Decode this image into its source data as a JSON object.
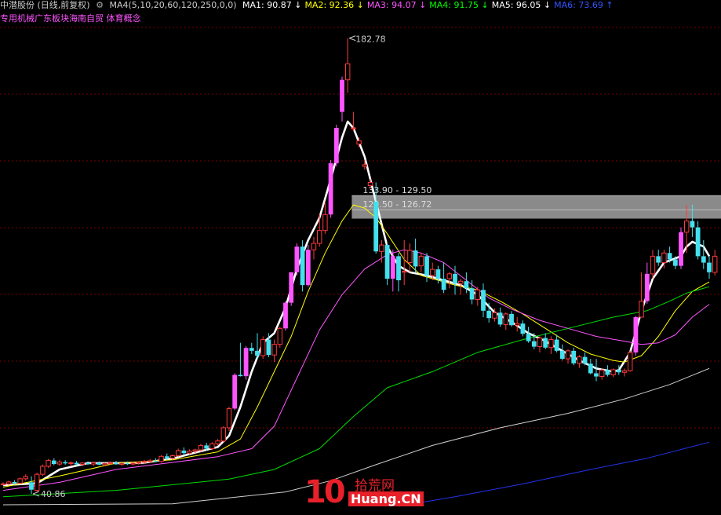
{
  "header": {
    "stock": "中潜股份 (日线,前复权)",
    "indicator": "MA4(5,10,20,60,120,250,0,0)",
    "ma": [
      {
        "label": "MA1: 90.87",
        "arrow": "↓",
        "color": "#ffffff"
      },
      {
        "label": "MA2: 92.36",
        "arrow": "↓",
        "color": "#ffff00"
      },
      {
        "label": "MA3: 94.07",
        "arrow": "↓",
        "color": "#ff55ff"
      },
      {
        "label": "MA4: 91.75",
        "arrow": "↓",
        "color": "#00ff00"
      },
      {
        "label": "MA5: 96.05",
        "arrow": "↓",
        "color": "#ffffff"
      },
      {
        "label": "MA6: 73.69",
        "arrow": "↑",
        "color": "#3355ff"
      }
    ],
    "concept": "专用机械广东板块海南自贸 体育概念"
  },
  "colors": {
    "up": "#ff3a3a",
    "down": "#44e0ee",
    "bigUp": "#ff55ff",
    "grid": "#7a0000",
    "gap": "#8a8a8a"
  },
  "chart_data": {
    "type": "candlestick",
    "ylim": [
      37,
      190
    ],
    "annotations": {
      "high": "182.78",
      "low": "40.86"
    },
    "gaps": [
      {
        "label": "133.90 - 129.50",
        "top": 133.9,
        "bottom": 129.5
      },
      {
        "label": "129.50 - 126.72",
        "top": 129.5,
        "bottom": 126.72
      }
    ],
    "candles": [
      [
        44,
        44.5,
        43.5,
        44
      ],
      [
        44,
        45,
        43.6,
        44.6
      ],
      [
        44.6,
        45.2,
        43.8,
        44.2
      ],
      [
        44.2,
        46,
        44,
        45.6
      ],
      [
        45.6,
        47,
        45,
        46.3
      ],
      [
        44.5,
        46.4,
        40.9,
        42.2
      ],
      [
        42,
        47.5,
        41.5,
        47
      ],
      [
        47,
        50,
        46.5,
        49.5
      ],
      [
        49.5,
        51.8,
        49,
        51.3
      ],
      [
        51.3,
        52,
        49.8,
        50.2
      ],
      [
        50.2,
        51.5,
        49.6,
        50.8
      ],
      [
        50.8,
        51.4,
        50,
        50.4
      ],
      [
        50.4,
        51,
        49.5,
        50.6
      ],
      [
        50.6,
        51.2,
        49.8,
        50.1
      ],
      [
        50.1,
        50.8,
        49.5,
        50.5
      ],
      [
        50.5,
        51,
        49.9,
        50.2
      ],
      [
        50.2,
        50.8,
        49.6,
        50.6
      ],
      [
        50.6,
        51,
        49.8,
        50
      ],
      [
        50,
        50.6,
        49.5,
        50.4
      ],
      [
        50.4,
        51,
        50,
        50.6
      ],
      [
        50.6,
        51.2,
        50,
        50.1
      ],
      [
        50.1,
        50.7,
        49.6,
        50.4
      ],
      [
        50.4,
        51,
        49.9,
        50.2
      ],
      [
        50.2,
        50.8,
        49.7,
        50.5
      ],
      [
        50.5,
        51,
        50,
        50.8
      ],
      [
        50.8,
        51.5,
        50.2,
        51
      ],
      [
        51,
        51.8,
        50.5,
        51.2
      ],
      [
        51.2,
        52,
        50.8,
        51
      ],
      [
        51,
        53,
        50.6,
        52.6
      ],
      [
        52.6,
        53.5,
        51.5,
        52
      ],
      [
        52,
        53.2,
        51.4,
        52.8
      ],
      [
        52.8,
        55,
        52.5,
        54.4
      ],
      [
        54.4,
        55.4,
        53,
        53.6
      ],
      [
        53.6,
        54.8,
        53.2,
        54.2
      ],
      [
        54.2,
        55,
        53.6,
        54.6
      ],
      [
        54.6,
        56.5,
        54,
        56
      ],
      [
        56,
        56.8,
        54.4,
        55
      ],
      [
        55,
        57,
        54.5,
        56.5
      ],
      [
        56.5,
        58,
        56,
        57.4
      ],
      [
        57.4,
        62,
        57,
        61.5
      ],
      [
        61.5,
        68,
        60.5,
        67.5
      ],
      [
        67.5,
        78.5,
        67,
        78
      ],
      [
        78,
        88,
        77.5,
        77.6
      ],
      [
        77.6,
        87,
        76.5,
        86.4
      ],
      [
        86.4,
        88,
        84.5,
        85.5
      ],
      [
        85.5,
        91,
        83,
        84
      ],
      [
        84,
        90,
        83,
        89
      ],
      [
        89,
        91,
        83.5,
        84.2
      ],
      [
        84.2,
        89,
        82,
        87.5
      ],
      [
        87.5,
        93,
        86.5,
        92.5
      ],
      [
        92.5,
        101,
        91.8,
        100.5
      ],
      [
        100.5,
        110,
        99.5,
        110
      ],
      [
        110,
        119,
        109,
        118
      ],
      [
        118,
        120,
        104,
        106
      ],
      [
        106,
        118.5,
        105.5,
        117
      ],
      [
        117,
        121,
        114,
        119
      ],
      [
        119,
        128,
        118,
        123
      ],
      [
        123,
        132,
        122,
        128
      ],
      [
        128,
        145,
        127,
        144
      ],
      [
        144,
        156,
        143,
        155
      ],
      [
        160,
        171,
        157,
        170
      ],
      [
        170,
        183,
        166,
        175
      ],
      [
        155,
        160,
        154,
        155
      ],
      [
        150,
        152,
        149,
        151
      ],
      [
        143,
        145,
        142,
        143.5
      ],
      [
        137,
        139,
        136,
        138
      ],
      [
        132,
        138,
        115.8,
        116.5
      ],
      [
        116.5,
        120,
        113,
        118.5
      ],
      [
        118.5,
        119,
        106,
        108
      ],
      [
        108,
        117,
        104,
        115
      ],
      [
        115,
        116,
        104,
        107.5
      ],
      [
        110,
        120,
        106,
        110.3
      ],
      [
        113,
        119,
        110,
        116.8
      ],
      [
        116.8,
        120.5,
        110,
        111.8
      ],
      [
        112,
        116,
        110,
        115
      ],
      [
        115,
        116,
        107,
        109
      ],
      [
        109,
        113,
        107.5,
        110.9
      ],
      [
        110.9,
        112,
        106.5,
        108
      ],
      [
        108,
        113,
        103.5,
        104.5
      ],
      [
        108,
        110,
        105,
        109.5
      ],
      [
        109.5,
        112,
        103,
        106.5
      ],
      [
        106.5,
        108,
        103,
        107.2
      ],
      [
        107.2,
        110,
        103.5,
        105
      ],
      [
        105,
        107.5,
        100,
        101.5
      ],
      [
        101.5,
        105.5,
        99.5,
        104.5
      ],
      [
        104.5,
        106.5,
        96,
        98
      ],
      [
        98,
        100.5,
        94.3,
        95.7
      ],
      [
        95.7,
        98.8,
        94.6,
        97.4
      ],
      [
        97.4,
        99,
        93,
        93.7
      ],
      [
        93.7,
        97.5,
        92,
        97
      ],
      [
        97,
        97.9,
        93,
        93.5
      ],
      [
        93.5,
        96,
        91.5,
        94
      ],
      [
        94,
        95,
        90,
        90.8
      ],
      [
        90.8,
        93,
        88,
        88.5
      ],
      [
        88.5,
        91,
        86,
        86.8
      ],
      [
        86.8,
        90,
        85,
        89.5
      ],
      [
        89.5,
        91,
        86,
        86.5
      ],
      [
        86.5,
        90,
        84.5,
        89
      ],
      [
        89,
        90.5,
        85,
        85.5
      ],
      [
        85.5,
        87.5,
        82.5,
        83
      ],
      [
        83,
        86,
        81.5,
        85.5
      ],
      [
        85.5,
        86.5,
        81,
        81.6
      ],
      [
        81.6,
        84.2,
        80.2,
        83.6
      ],
      [
        83.6,
        85,
        81,
        81.5
      ],
      [
        81.5,
        83,
        78.2,
        78.5
      ],
      [
        78.5,
        83,
        76,
        77.5
      ],
      [
        77.5,
        80,
        76.5,
        79.5
      ],
      [
        79.5,
        81,
        77.5,
        78
      ],
      [
        78,
        80,
        77.3,
        79.6
      ],
      [
        79.6,
        81,
        78,
        78.8
      ],
      [
        78.8,
        80,
        77.5,
        79.3
      ],
      [
        79.3,
        85.5,
        79,
        85
      ],
      [
        85,
        96.4,
        84,
        96
      ],
      [
        96,
        110,
        96.2,
        101
      ],
      [
        101,
        113,
        100.2,
        109.5
      ],
      [
        109.5,
        117,
        108,
        115
      ],
      [
        115,
        117,
        112,
        113
      ],
      [
        113,
        117,
        111.2,
        116
      ],
      [
        116,
        118,
        113,
        114
      ],
      [
        114,
        115,
        111,
        112
      ],
      [
        112,
        124,
        111,
        122.5
      ],
      [
        122.5,
        131,
        116,
        126
      ],
      [
        126,
        131,
        121,
        124
      ],
      [
        124,
        126,
        114,
        115
      ],
      [
        115,
        120,
        111,
        113
      ],
      [
        113,
        115,
        108,
        110
      ],
      [
        110,
        117,
        109,
        115
      ]
    ],
    "ma_series": [
      {
        "name": "MA1",
        "color": "#ffffff",
        "width": 2.6,
        "points": [
          [
            0,
            43.6
          ],
          [
            6,
            44.2
          ],
          [
            10,
            48.5
          ],
          [
            15,
            50.5
          ],
          [
            20,
            50.5
          ],
          [
            25,
            50.6
          ],
          [
            30,
            51.9
          ],
          [
            35,
            54.2
          ],
          [
            38,
            55.5
          ],
          [
            40,
            59
          ],
          [
            42,
            68
          ],
          [
            44,
            79
          ],
          [
            46,
            88
          ],
          [
            48,
            91
          ],
          [
            50,
            99
          ],
          [
            52,
            111
          ],
          [
            54,
            120
          ],
          [
            56,
            127
          ],
          [
            58,
            139
          ],
          [
            60,
            152
          ],
          [
            61,
            157
          ],
          [
            62,
            155
          ],
          [
            64,
            146
          ],
          [
            66,
            132
          ],
          [
            68,
            118
          ],
          [
            70,
            112
          ],
          [
            72,
            110
          ],
          [
            75,
            109
          ],
          [
            78,
            107.5
          ],
          [
            81,
            106
          ],
          [
            84,
            103
          ],
          [
            87,
            97.5
          ],
          [
            90,
            94.5
          ],
          [
            93,
            91
          ],
          [
            96,
            88.5
          ],
          [
            99,
            85.5
          ],
          [
            102,
            82.5
          ],
          [
            105,
            80
          ],
          [
            108,
            79
          ],
          [
            109,
            79.5
          ],
          [
            111,
            85
          ],
          [
            113,
            98
          ],
          [
            115,
            108
          ],
          [
            117,
            113
          ],
          [
            120,
            115
          ],
          [
            121,
            118
          ],
          [
            122,
            119.5
          ],
          [
            124,
            118
          ],
          [
            125,
            115
          ]
        ]
      },
      {
        "name": "MA2",
        "color": "#ffff00",
        "width": 1,
        "points": [
          [
            0,
            43
          ],
          [
            10,
            46.5
          ],
          [
            20,
            50.5
          ],
          [
            30,
            51.5
          ],
          [
            38,
            54
          ],
          [
            42,
            58
          ],
          [
            45,
            68
          ],
          [
            48,
            79
          ],
          [
            51,
            90
          ],
          [
            54,
            104
          ],
          [
            57,
            116
          ],
          [
            60,
            126
          ],
          [
            62,
            131
          ],
          [
            64,
            130
          ],
          [
            66,
            127
          ],
          [
            68,
            122
          ],
          [
            71,
            114
          ],
          [
            74,
            109
          ],
          [
            77,
            107.5
          ],
          [
            80,
            106
          ],
          [
            84,
            104.5
          ],
          [
            88,
            101
          ],
          [
            92,
            97
          ],
          [
            96,
            92.5
          ],
          [
            100,
            88
          ],
          [
            104,
            84.5
          ],
          [
            108,
            82.5
          ],
          [
            110,
            82
          ],
          [
            113,
            84
          ],
          [
            116,
            90
          ],
          [
            119,
            98
          ],
          [
            122,
            104
          ],
          [
            125,
            107
          ]
        ]
      },
      {
        "name": "MA3",
        "color": "#ff55ff",
        "width": 1,
        "points": [
          [
            0,
            42
          ],
          [
            10,
            44.5
          ],
          [
            20,
            48.5
          ],
          [
            30,
            50.7
          ],
          [
            38,
            52.5
          ],
          [
            44,
            55
          ],
          [
            48,
            62
          ],
          [
            52,
            77
          ],
          [
            56,
            92
          ],
          [
            60,
            103
          ],
          [
            64,
            111
          ],
          [
            68,
            115.5
          ],
          [
            71,
            117
          ],
          [
            74,
            116
          ],
          [
            78,
            113
          ],
          [
            82,
            107.5
          ],
          [
            86,
            102
          ],
          [
            90,
            98.5
          ],
          [
            95,
            95
          ],
          [
            100,
            92.5
          ],
          [
            105,
            90
          ],
          [
            110,
            88.5
          ],
          [
            113,
            87.5
          ],
          [
            116,
            88
          ],
          [
            119,
            90.5
          ],
          [
            122,
            96
          ],
          [
            125,
            100
          ]
        ]
      },
      {
        "name": "MA4",
        "color": "#00dd00",
        "width": 1,
        "points": [
          [
            0,
            40
          ],
          [
            20,
            42
          ],
          [
            40,
            45.5
          ],
          [
            48,
            48.5
          ],
          [
            56,
            55
          ],
          [
            62,
            65
          ],
          [
            68,
            74
          ],
          [
            76,
            79
          ],
          [
            84,
            85
          ],
          [
            92,
            89
          ],
          [
            100,
            92.5
          ],
          [
            108,
            96
          ],
          [
            114,
            98
          ],
          [
            118,
            101
          ],
          [
            121,
            103.5
          ],
          [
            125,
            105.5
          ]
        ]
      },
      {
        "name": "MA5",
        "color": "#cfcfcf",
        "width": 1,
        "points": [
          [
            0,
            37.5
          ],
          [
            30,
            37.8
          ],
          [
            50,
            41.5
          ],
          [
            58,
            45
          ],
          [
            66,
            50
          ],
          [
            76,
            56
          ],
          [
            88,
            61.5
          ],
          [
            100,
            66
          ],
          [
            110,
            70.5
          ],
          [
            118,
            75
          ],
          [
            125,
            80
          ]
        ]
      },
      {
        "name": "MA6",
        "color": "#2233ee",
        "width": 1,
        "points": [
          [
            70,
            37
          ],
          [
            80,
            40
          ],
          [
            92,
            44
          ],
          [
            104,
            48.5
          ],
          [
            114,
            52
          ],
          [
            125,
            57
          ]
        ]
      }
    ]
  },
  "watermark": {
    "num": "10",
    "cn": "拾荒网",
    "en": "Huang.CN"
  }
}
